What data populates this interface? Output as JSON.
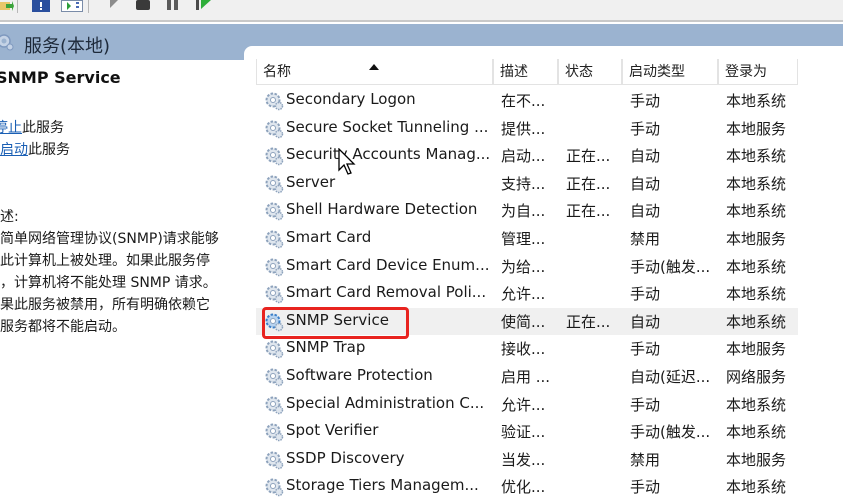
{
  "toolbar": {
    "buttons": [
      {
        "name": "export-list-icon"
      },
      {
        "name": "help-icon"
      },
      {
        "name": "show-hide-action-pane-icon"
      },
      {
        "name": "start-service-icon"
      },
      {
        "name": "stop-service-icon"
      },
      {
        "name": "pause-service-icon"
      },
      {
        "name": "restart-service-icon"
      }
    ]
  },
  "header": {
    "title": "服务(本地)"
  },
  "left_pane": {
    "service_title": "SNMP Service",
    "actions": [
      {
        "link": "停止",
        "suffix": "此服务"
      },
      {
        "link": "重启动",
        "suffix": "此服务"
      }
    ],
    "desc_label": "描述:",
    "desc_text": "使简单网络管理协议(SNMP)请求能够\n被此计算机上被处理。如果此服务停\n止，计算机将不能处理 SNMP 请求。\n如果此服务被禁用，所有明确依赖它\n的服务都将不能启动。"
  },
  "table": {
    "columns": [
      "名称",
      "描述",
      "状态",
      "启动类型",
      "登录为"
    ],
    "sort_column": "名称",
    "rows": [
      {
        "name": "Secondary Logon",
        "desc": "在不...",
        "status": "",
        "startup": "手动",
        "logon": "本地系统"
      },
      {
        "name": "Secure Socket Tunneling ...",
        "desc": "提供...",
        "status": "",
        "startup": "手动",
        "logon": "本地服务"
      },
      {
        "name": "Security Accounts Manag...",
        "desc": "启动...",
        "status": "正在...",
        "startup": "自动",
        "logon": "本地系统"
      },
      {
        "name": "Server",
        "desc": "支持...",
        "status": "正在...",
        "startup": "自动",
        "logon": "本地系统"
      },
      {
        "name": "Shell Hardware Detection",
        "desc": "为自...",
        "status": "正在...",
        "startup": "自动",
        "logon": "本地系统"
      },
      {
        "name": "Smart Card",
        "desc": "管理...",
        "status": "",
        "startup": "禁用",
        "logon": "本地服务"
      },
      {
        "name": "Smart Card Device Enum...",
        "desc": "为给...",
        "status": "",
        "startup": "手动(触发...",
        "logon": "本地系统"
      },
      {
        "name": "Smart Card Removal Poli...",
        "desc": "允许...",
        "status": "",
        "startup": "手动",
        "logon": "本地系统"
      },
      {
        "name": "SNMP Service",
        "desc": "使简...",
        "status": "正在...",
        "startup": "自动",
        "logon": "本地系统"
      },
      {
        "name": "SNMP Trap",
        "desc": "接收...",
        "status": "",
        "startup": "手动",
        "logon": "本地服务"
      },
      {
        "name": "Software Protection",
        "desc": "启用 ...",
        "status": "",
        "startup": "自动(延迟...",
        "logon": "网络服务"
      },
      {
        "name": "Special Administration C...",
        "desc": "允许...",
        "status": "",
        "startup": "手动",
        "logon": "本地系统"
      },
      {
        "name": "Spot Verifier",
        "desc": "验证...",
        "status": "",
        "startup": "手动(触发...",
        "logon": "本地系统"
      },
      {
        "name": "SSDP Discovery",
        "desc": "当发...",
        "status": "",
        "startup": "禁用",
        "logon": "本地服务"
      },
      {
        "name": "Storage Tiers Managem...",
        "desc": "优化...",
        "status": "",
        "startup": "手动",
        "logon": "本地系统"
      }
    ],
    "selected_row": "SNMP Service"
  },
  "colors": {
    "header_band": "#9bb3d0",
    "highlight_box": "#e8231f",
    "link": "#1a5fb4"
  }
}
